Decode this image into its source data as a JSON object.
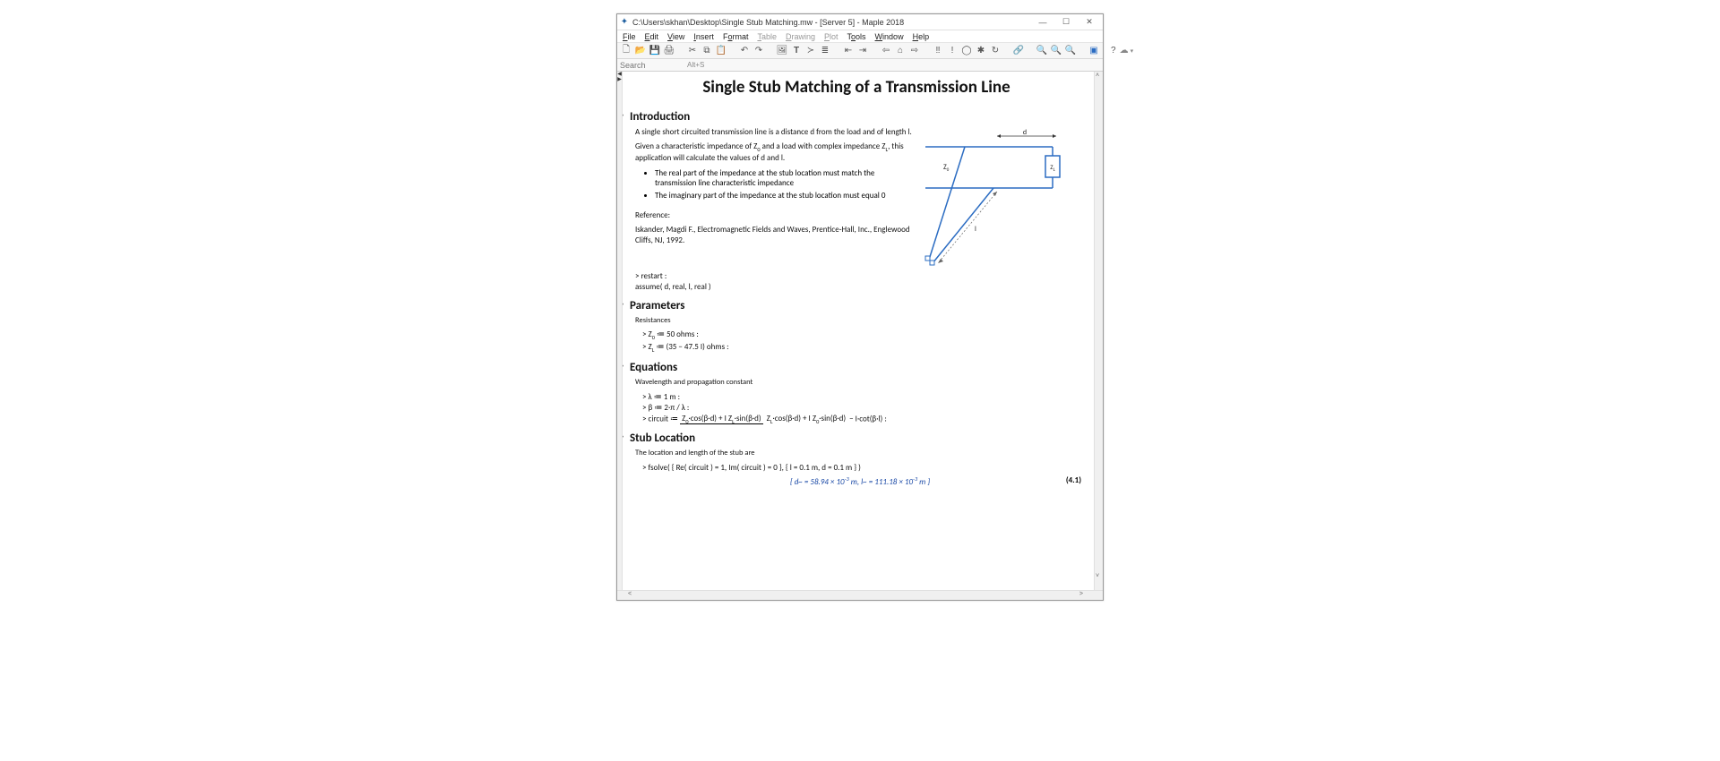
{
  "window": {
    "title": "C:\\Users\\skhan\\Desktop\\Single Stub Matching.mw - [Server 5] - Maple 2018",
    "minimize": "—",
    "maximize": "☐",
    "close": "✕"
  },
  "menu": {
    "file": "File",
    "edit": "Edit",
    "view": "View",
    "insert": "Insert",
    "format": "Format",
    "table": "Table",
    "drawing": "Drawing",
    "plot": "Plot",
    "tools": "Tools",
    "window": "Window",
    "help": "Help"
  },
  "search": {
    "placeholder": "Search",
    "hint": "Alt+S"
  },
  "doc": {
    "title": "Single Stub Matching of a Transmission Line",
    "introduction": {
      "heading": "Introduction",
      "p1": "A single short circuited transmission line is a distance d from the load and of length l.",
      "p2a": "Given a characteristic impedance of Z",
      "p2b": " and a load with complex impedance Z",
      "p2c": ", this application will calculate the values of d and l.",
      "b1": "The real part of the impedance at the stub location must match the transmission line characteristic impedance",
      "b2": "The imaginary part of the impedance at the stub location must equal 0",
      "ref_h": "Reference:",
      "ref": "Iskander, Magdi F., Electromagnetic Fields and Waves, Prentice-Hall, Inc., Englewood Cliffs, NJ, 1992.",
      "code1": "restart :",
      "code2": "assume( d, real, l, real )"
    },
    "parameters": {
      "heading": "Parameters",
      "sub": "Resistances",
      "z0": "Z",
      "z0v": " ≔ 50 ohms :",
      "zl": "Z",
      "zlv": " ≔ (35 − 47.5 I) ohms :"
    },
    "equations": {
      "heading": "Equations",
      "sub": "Wavelength and propagation constant",
      "lambda": "λ ≔ 1 m :",
      "beta": "β ≔ 2·π / λ :",
      "circuit_lhs": "circuit ≔ ",
      "num": "Z₀ · cos(β·d) + I Z_L · sin(β·d)",
      "den": "Z_L · cos(β·d) + I Z₀ · sin(β·d)",
      "tail": " − I·cot(β·l) :"
    },
    "stub": {
      "heading": "Stub Location",
      "sub": "The location and length of the stub are",
      "fsolve": "fsolve( { Re( circuit ) = 1, Im( circuit ) = 0 },  { l = 0.1 m, d = 0.1 m } )",
      "result": "{ d~ = 58.94 × 10⁻³ m, l~ = 111.18 × 10⁻³ m }",
      "eqlabel": "(4.1)"
    },
    "diagram": {
      "d": "d",
      "z0": "Z₀",
      "zl": "Z_L",
      "l": "l"
    }
  }
}
